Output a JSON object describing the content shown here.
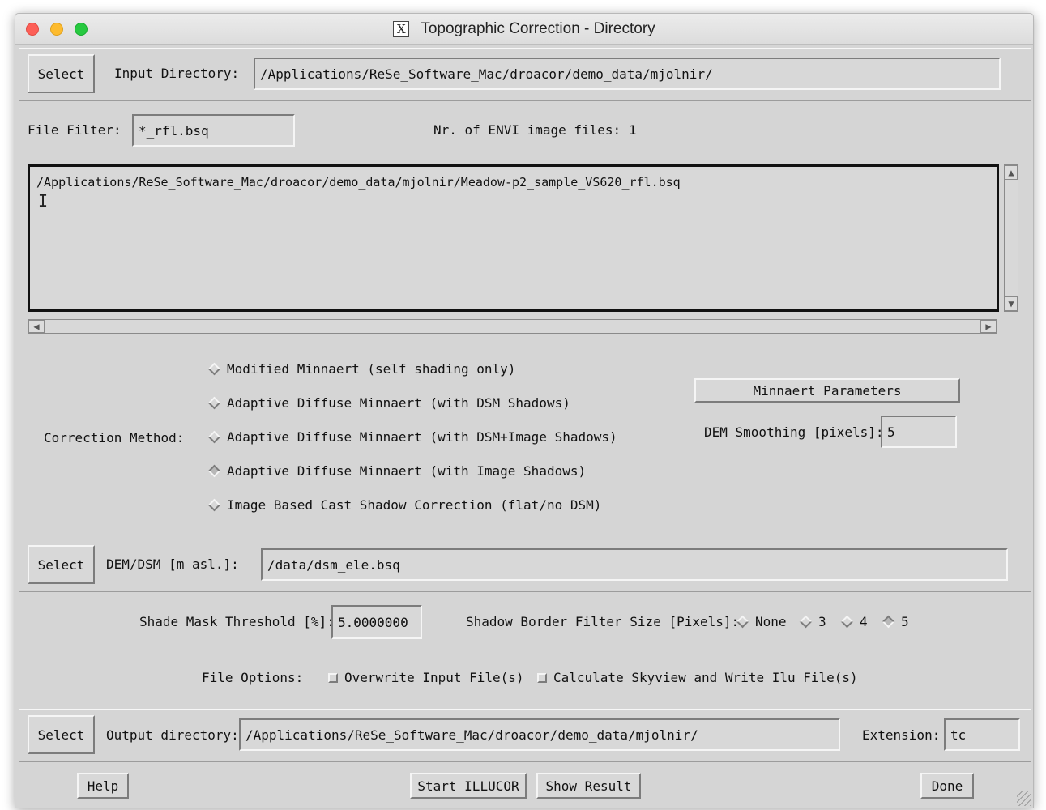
{
  "window": {
    "title": "Topographic Correction - Directory",
    "app_icon": "x11-icon",
    "traffic_lights": [
      "close",
      "minimize",
      "zoom"
    ]
  },
  "input": {
    "select_label": "Select",
    "directory_label": "Input Directory:",
    "directory_value": "/Applications/ReSe_Software_Mac/droacor/demo_data/mjolnir/"
  },
  "filter": {
    "label": "File Filter:",
    "value": "*_rfl.bsq",
    "count_label": "Nr. of ENVI image files: 1"
  },
  "file_list": {
    "items": [
      "/Applications/ReSe_Software_Mac/droacor/demo_data/mjolnir/Meadow-p2_sample_VS620_rfl.bsq"
    ]
  },
  "correction": {
    "label": "Correction Method:",
    "options": [
      {
        "label": "Modified Minnaert (self shading only)",
        "selected": false
      },
      {
        "label": "Adaptive Diffuse Minnaert (with DSM Shadows)",
        "selected": false
      },
      {
        "label": "Adaptive Diffuse Minnaert (with DSM+Image Shadows)",
        "selected": false
      },
      {
        "label": "Adaptive Diffuse Minnaert (with Image Shadows)",
        "selected": true
      },
      {
        "label": "Image Based Cast Shadow Correction (flat/no DSM)",
        "selected": false
      }
    ],
    "minnaert_button": "Minnaert Parameters",
    "smoothing_label": "DEM Smoothing [pixels]:",
    "smoothing_value": "5"
  },
  "dem": {
    "select_label": "Select",
    "label": "DEM/DSM [m asl.]:",
    "value": "/data/dsm_ele.bsq"
  },
  "shade": {
    "threshold_label": "Shade Mask Threshold [%]:",
    "threshold_value": "5.0000000",
    "border_label": "Shadow Border Filter Size [Pixels]:",
    "border_options": [
      {
        "label": "None",
        "selected": false
      },
      {
        "label": "3",
        "selected": false
      },
      {
        "label": "4",
        "selected": false
      },
      {
        "label": "5",
        "selected": true
      }
    ]
  },
  "file_options": {
    "label": "File Options:",
    "overwrite_label": "Overwrite Input File(s)",
    "overwrite_checked": false,
    "skyview_label": "Calculate Skyview and Write Ilu File(s)",
    "skyview_checked": false
  },
  "output": {
    "select_label": "Select",
    "directory_label": "Output directory:",
    "directory_value": "/Applications/ReSe_Software_Mac/droacor/demo_data/mjolnir/",
    "extension_label": "Extension:",
    "extension_value": "tc"
  },
  "bottom": {
    "help": "Help",
    "start": "Start ILLUCOR",
    "show_result": "Show Result",
    "done": "Done"
  }
}
